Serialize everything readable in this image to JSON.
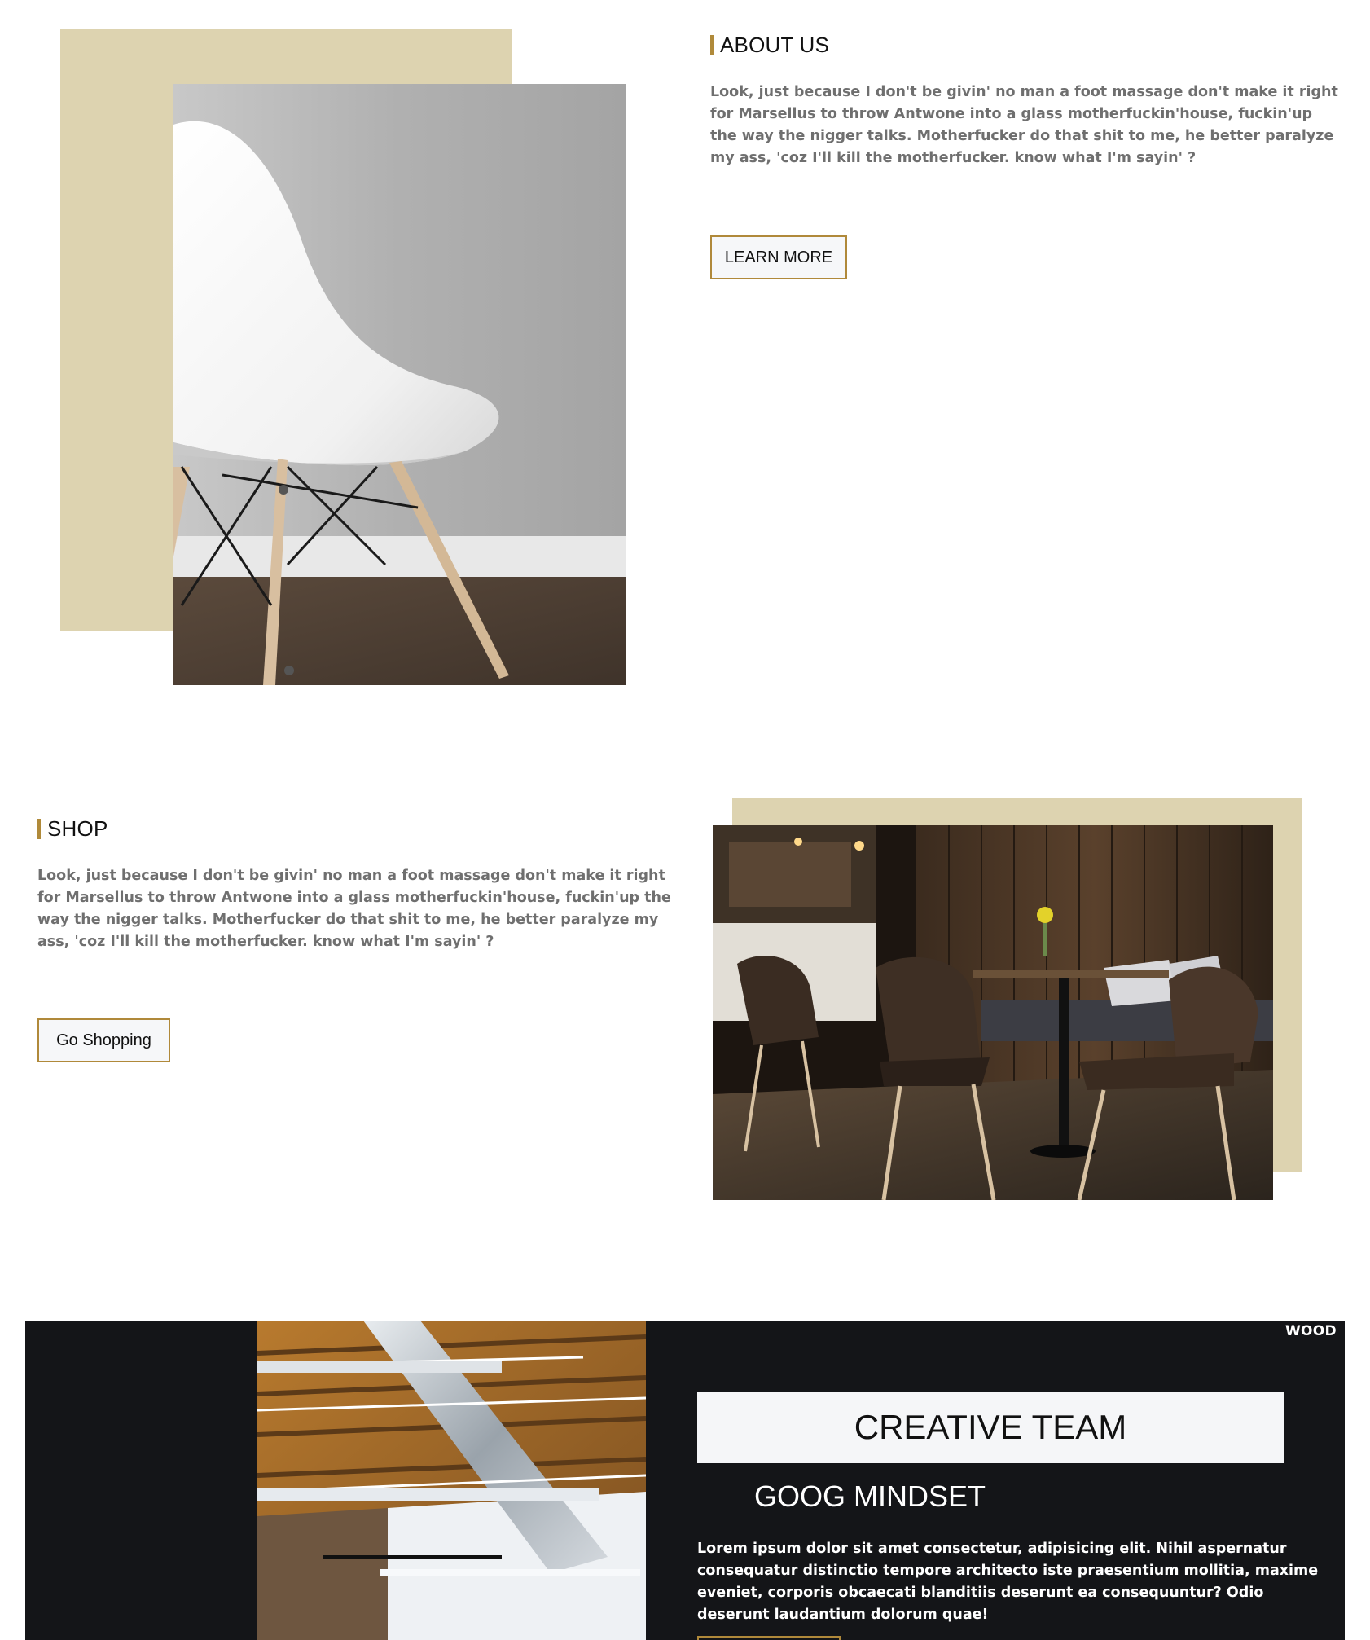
{
  "about": {
    "heading": "ABOUT US",
    "text": "Look, just because I don't be givin' no man a foot massage don't make it right for Marsellus to throw Antwone into a glass motherfuckin'house, fuckin'up the way the nigger talks. Motherfucker do that shit to me, he better paralyze my ass, 'coz I'll kill the motherfucker. know what I'm sayin' ?",
    "button_label": "LEARN MORE",
    "image_alt": "White molded chair against grey wall"
  },
  "shop": {
    "heading": "SHOP",
    "text": "Look, just because I don't be givin' no man a foot massage don't make it right for Marsellus to throw Antwone into a glass motherfuckin'house, fuckin'up the way the nigger talks. Motherfucker do that shit to me, he better paralyze my ass, 'coz I'll kill the motherfucker. know what I'm sayin' ?",
    "button_label": "Go Shopping",
    "image_alt": "Cafe interior with leather chairs and wooden wall"
  },
  "team": {
    "label": "WOOD",
    "title": "CREATIVE TEAM",
    "subtitle": "GOOG MINDSET",
    "text": "Lorem ipsum dolor sit amet consectetur, adipisicing elit. Nihil aspernatur consequatur distinctio tempore architecto iste praesentium mollitia, maxime eveniet, corporis obcaecati blanditiis deserunt ea consequuntur? Odio deserunt laudantium dolorum quae!",
    "image_alt": "Industrial ceiling with ducts and wood beams"
  },
  "colors": {
    "accent": "#b08a3a",
    "tan": "#ddd3b0",
    "dark": "#141518"
  }
}
